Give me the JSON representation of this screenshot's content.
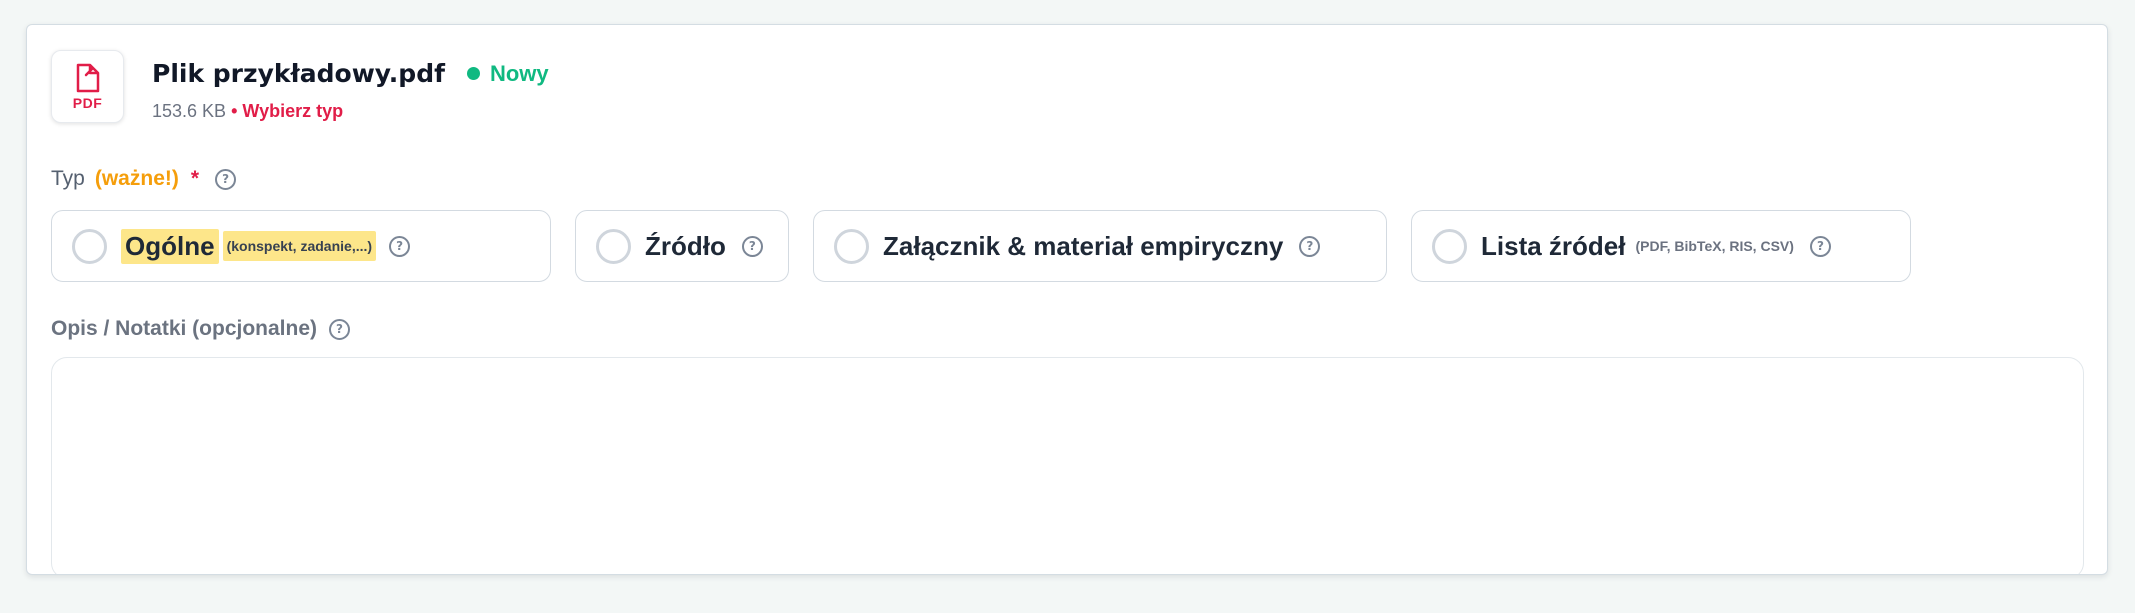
{
  "file": {
    "icon_label": "PDF",
    "name": "Plik przykładowy.pdf",
    "status": "Nowy",
    "size": "153.6 KB",
    "separator": "•",
    "type_hint": "Wybierz typ",
    "colors": {
      "status": "#10b981",
      "warning": "#e11d48"
    }
  },
  "type_field": {
    "label": "Typ",
    "important": "(ważne!)",
    "required_marker": "*",
    "help": "?",
    "options": [
      {
        "label": "Ogólne",
        "note": "(konspekt, zadanie,...)",
        "help": "?",
        "highlighted": true
      },
      {
        "label": "Źródło",
        "note": "",
        "help": "?"
      },
      {
        "label": "Załącznik & materiał empiryczny",
        "note": "",
        "help": "?"
      },
      {
        "label": "Lista źródeł",
        "note": "(PDF, BibTeX, RIS, CSV)",
        "help": "?"
      }
    ]
  },
  "description": {
    "label": "Opis / Notatki (opcjonalne)",
    "help": "?",
    "value": ""
  }
}
